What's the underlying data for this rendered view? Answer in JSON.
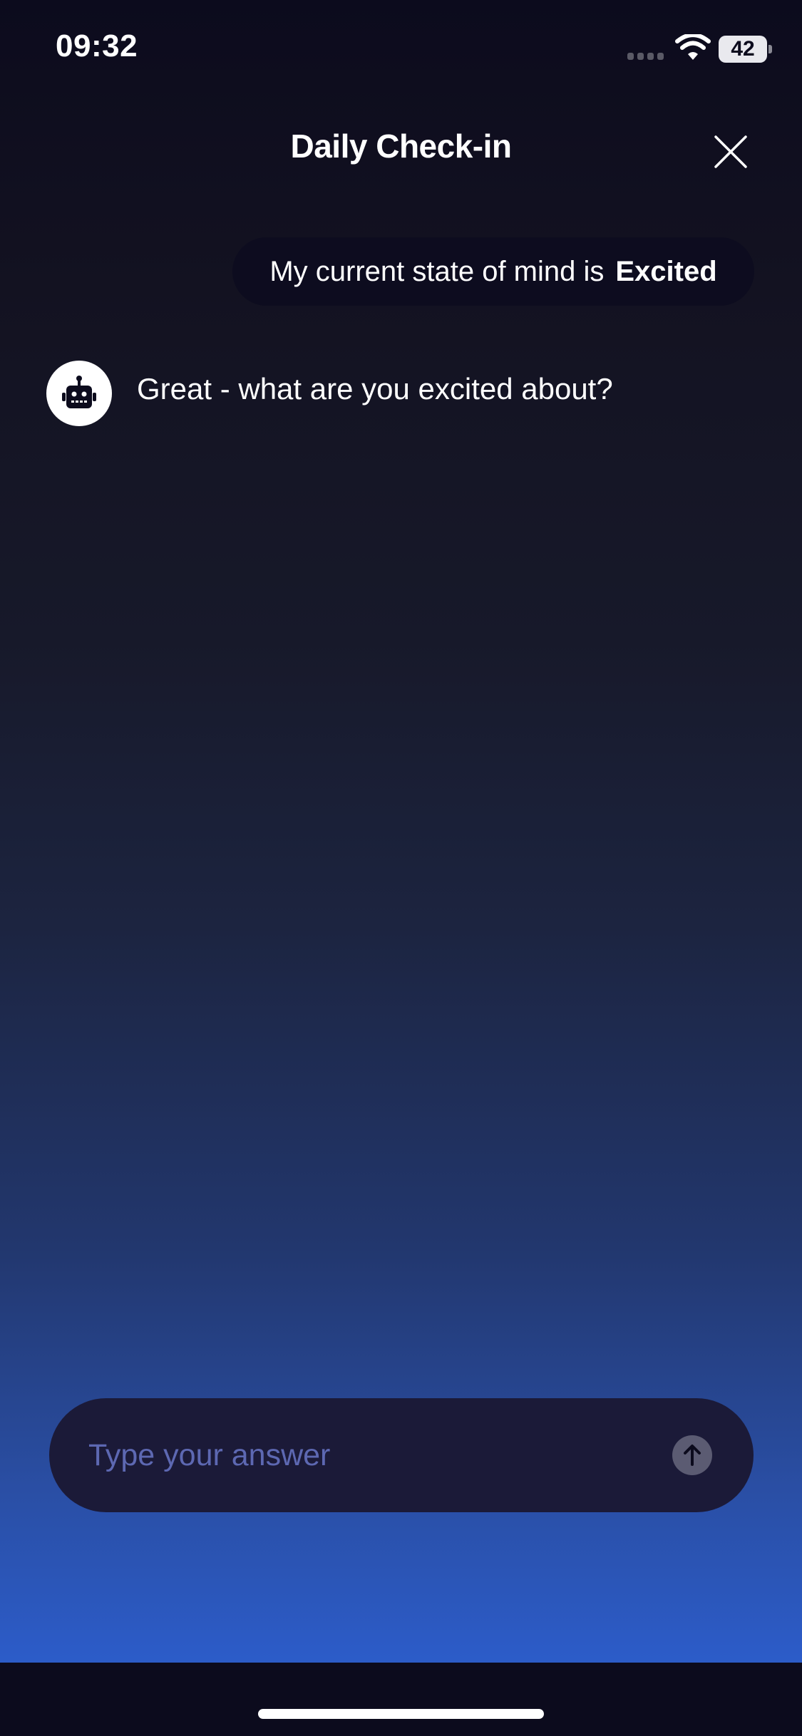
{
  "status_bar": {
    "time": "09:32",
    "battery_level": "42"
  },
  "header": {
    "title": "Daily Check-in",
    "close_icon": "close-icon"
  },
  "conversation": {
    "user_message": {
      "prefix": "My current state of mind is",
      "mood": "Excited"
    },
    "bot_message": {
      "avatar_icon": "robot-icon",
      "text": "Great - what are you excited about?"
    }
  },
  "composer": {
    "placeholder": "Type your answer",
    "value": "",
    "send_icon": "arrow-up-icon"
  },
  "colors": {
    "background_top": "#0c0b1d",
    "background_bottom": "#2c5cc9",
    "bubble": "#0d0c1f",
    "input_background": "#1b1a38",
    "placeholder": "#5d68b2"
  }
}
